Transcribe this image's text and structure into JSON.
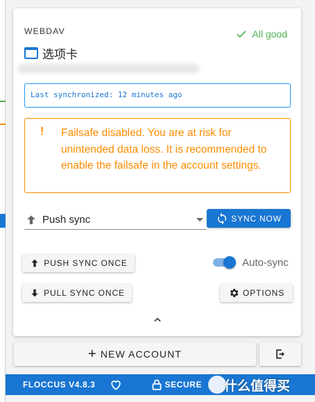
{
  "account": {
    "type_label": "WEBDAV",
    "status_label": "All good",
    "name": "选项卡",
    "last_synchronized": "Last synchronized: 12 minutes ago"
  },
  "warning": {
    "mark": "!",
    "text": "Failsafe disabled. You are at risk for unintended data loss. It is recommended to enable the failsafe in the account settings."
  },
  "controls": {
    "strategy_value": "Push sync",
    "sync_now_label": "SYNC NOW",
    "push_once_label": "PUSH SYNC ONCE",
    "pull_once_label": "PULL SYNC ONCE",
    "autosync_label": "Auto-sync",
    "autosync_enabled": true,
    "options_label": "OPTIONS"
  },
  "actions": {
    "new_account_label": "NEW ACCOUNT",
    "new_account_plus": "+"
  },
  "footer": {
    "version": "FLOCCUS V4.8.3",
    "secure_label": "SECURE",
    "watermark": "什么值得买"
  },
  "colors": {
    "primary": "#1976d2",
    "success": "#4caf50",
    "warning": "#fb8c00"
  }
}
